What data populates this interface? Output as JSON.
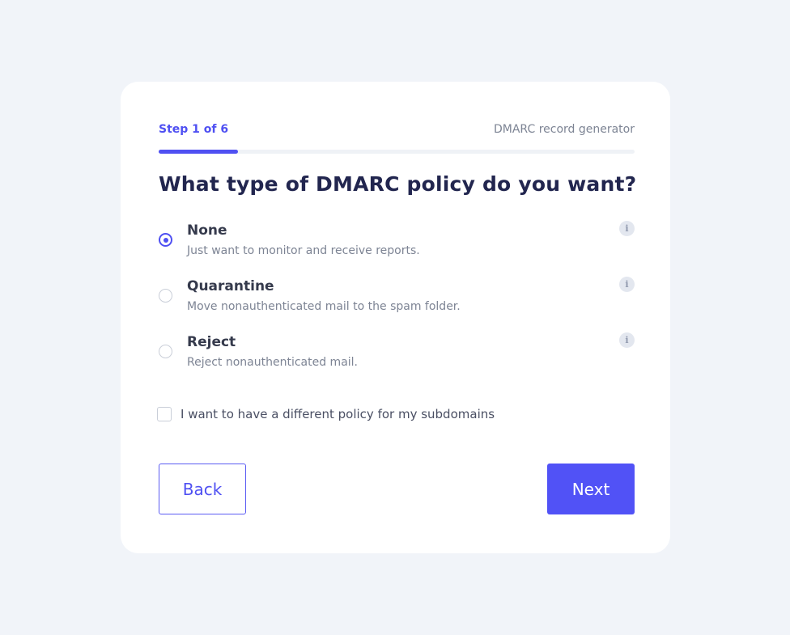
{
  "header": {
    "step_label": "Step 1 of 6",
    "tool_name": "DMARC record generator",
    "progress_fraction": 0.1667
  },
  "question": "What type of DMARC policy do you want?",
  "options": [
    {
      "label": "None",
      "description": "Just want to monitor and receive reports.",
      "selected": true,
      "info_icon": "info-icon"
    },
    {
      "label": "Quarantine",
      "description": "Move nonauthenticated mail to the spam folder.",
      "selected": false,
      "info_icon": "info-icon"
    },
    {
      "label": "Reject",
      "description": "Reject nonauthenticated mail.",
      "selected": false,
      "info_icon": "info-icon"
    }
  ],
  "info_glyph": "i",
  "subdomain_checkbox": {
    "label": "I want to have a different policy for my subdomains",
    "checked": false
  },
  "buttons": {
    "back_label": "Back",
    "next_label": "Next"
  },
  "colors": {
    "accent": "#4f50f2",
    "page_background": "#f1f4f9",
    "heading": "#22264f"
  }
}
